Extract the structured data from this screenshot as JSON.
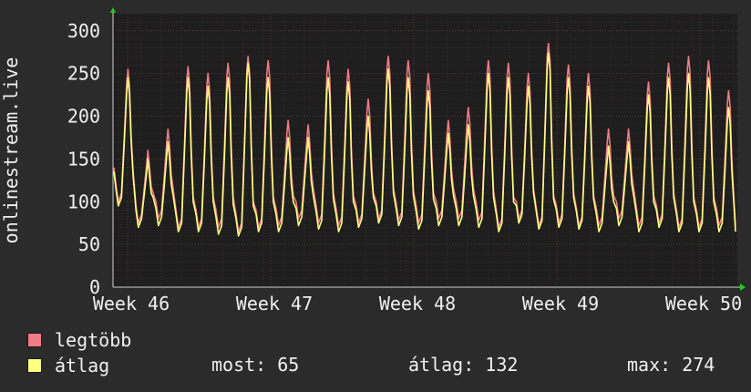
{
  "chart_data": {
    "type": "line",
    "ylabel": "onlinestream.live",
    "ylim": [
      0,
      320
    ],
    "y_ticks": [
      "0",
      "50",
      "100",
      "150",
      "200",
      "250",
      "300"
    ],
    "x_ticks": [
      "Week 46",
      "Week 47",
      "Week 48",
      "Week 49",
      "Week 50"
    ],
    "grid": true,
    "background": "#1e1e1e",
    "grid_color": "#5a3535",
    "series": [
      {
        "name": "legtöbb",
        "color": "#f07a85",
        "peaks": [
          255,
          160,
          185,
          258,
          250,
          262,
          270,
          265,
          195,
          190,
          265,
          255,
          220,
          270,
          265,
          250,
          195,
          210,
          265,
          262,
          250,
          285,
          260,
          250,
          185,
          185,
          240,
          262,
          270,
          265,
          230
        ],
        "troughs": [
          100,
          75,
          80,
          70,
          70,
          70,
          65,
          70,
          72,
          80,
          75,
          72,
          75,
          80,
          78,
          75,
          80,
          80,
          78,
          70,
          80,
          72,
          75,
          72,
          72,
          80,
          72,
          75,
          70,
          70,
          72
        ]
      },
      {
        "name": "átlag",
        "color": "#ffff80",
        "peaks": [
          245,
          150,
          170,
          245,
          235,
          245,
          262,
          245,
          175,
          175,
          245,
          240,
          200,
          255,
          245,
          230,
          180,
          190,
          250,
          245,
          235,
          274,
          245,
          235,
          165,
          170,
          225,
          245,
          250,
          245,
          210
        ],
        "troughs": [
          95,
          70,
          72,
          65,
          65,
          62,
          60,
          65,
          65,
          72,
          68,
          65,
          70,
          75,
          72,
          68,
          72,
          72,
          70,
          65,
          75,
          68,
          70,
          68,
          65,
          72,
          65,
          70,
          65,
          65,
          65
        ]
      }
    ]
  },
  "legend": {
    "max_label": "legtöbb",
    "avg_label": "átlag",
    "colors": {
      "max": "#f07a85",
      "avg": "#ffff80"
    }
  },
  "stats": {
    "current": "most: 65",
    "average": "átlag: 132",
    "maximum": "max: 274"
  }
}
